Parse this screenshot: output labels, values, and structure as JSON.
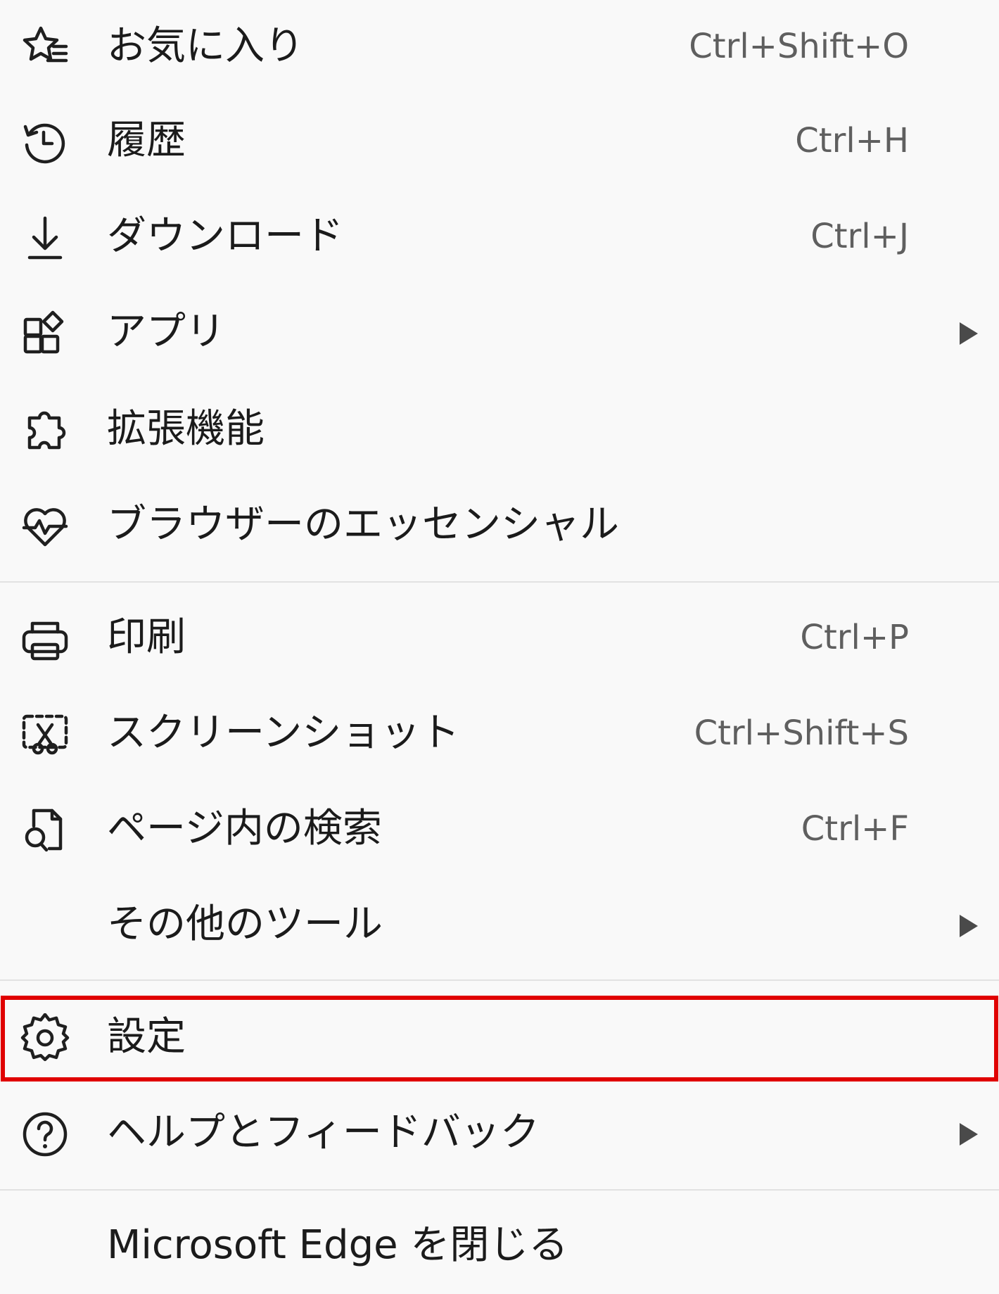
{
  "menu": {
    "items": [
      {
        "label": "お気に入り",
        "shortcut": "Ctrl+Shift+O",
        "icon": "favorites-star-icon"
      },
      {
        "label": "履歴",
        "shortcut": "Ctrl+H",
        "icon": "history-clock-icon"
      },
      {
        "label": "ダウンロード",
        "shortcut": "Ctrl+J",
        "icon": "download-arrow-icon"
      },
      {
        "label": "アプリ",
        "shortcut": "",
        "icon": "apps-grid-icon"
      },
      {
        "label": "拡張機能",
        "shortcut": "",
        "icon": "puzzle-piece-icon"
      },
      {
        "label": "ブラウザーのエッセンシャル",
        "shortcut": "",
        "icon": "heart-pulse-icon"
      },
      {
        "label": "印刷",
        "shortcut": "Ctrl+P",
        "icon": "printer-icon"
      },
      {
        "label": "スクリーンショット",
        "shortcut": "Ctrl+Shift+S",
        "icon": "screenshot-scissors-icon"
      },
      {
        "label": "ページ内の検索",
        "shortcut": "Ctrl+F",
        "icon": "find-in-page-icon"
      },
      {
        "label": "その他のツール",
        "shortcut": ""
      },
      {
        "label": "設定",
        "shortcut": "",
        "icon": "gear-icon"
      },
      {
        "label": "ヘルプとフィードバック",
        "shortcut": "",
        "icon": "help-circle-icon"
      },
      {
        "label": "Microsoft Edge を閉じる",
        "shortcut": ""
      }
    ],
    "highlight_color": "#e00000",
    "highlighted_item": "設定"
  }
}
